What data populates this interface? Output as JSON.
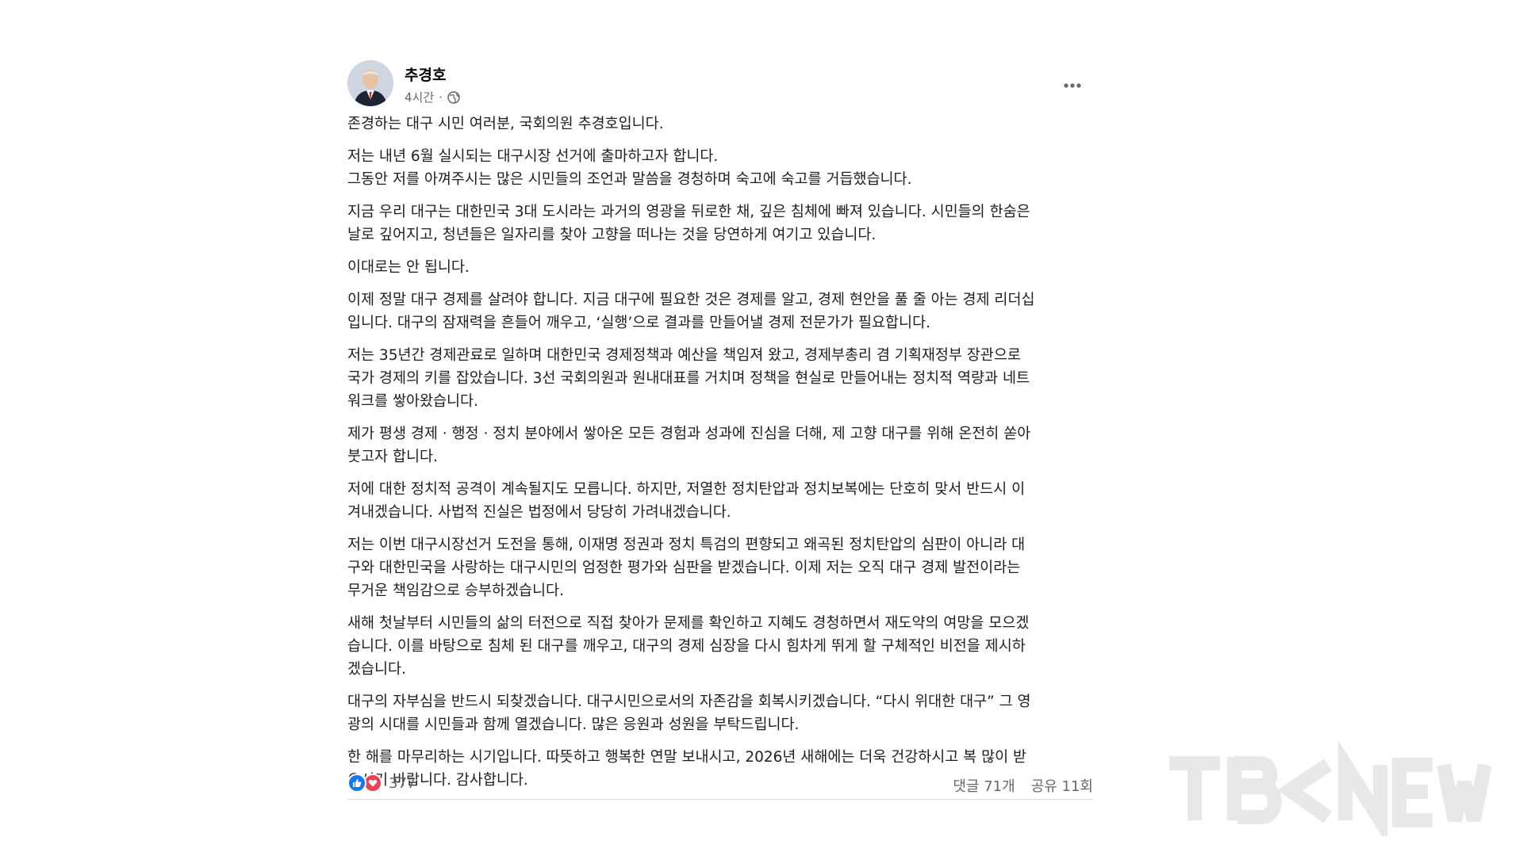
{
  "post": {
    "author": "추경호",
    "time": "4시간",
    "meta_separator": "·",
    "privacy_icon": "globe-icon",
    "more_icon": "more-options-icon",
    "paragraphs": [
      "존경하는 대구 시민 여러분, 국회의원 추경호입니다.",
      "저는 내년 6월 실시되는 대구시장 선거에 출마하고자 합니다.\n그동안 저를 아껴주시는 많은 시민들의 조언과 말씀을 경청하며 숙고에 숙고를 거듭했습니다.",
      "지금 우리 대구는 대한민국 3대 도시라는 과거의 영광을 뒤로한 채, 깊은 침체에 빠져 있습니다. 시민들의 한숨은\n날로 깊어지고, 청년들은 일자리를 찾아 고향을 떠나는 것을 당연하게 여기고 있습니다.",
      "이대로는 안 됩니다.",
      "이제 정말 대구 경제를 살려야 합니다. 지금 대구에 필요한 것은 경제를 알고, 경제 현안을 풀 줄 아는 경제 리더십\n입니다. 대구의 잠재력을 흔들어 깨우고, ‘실행’으로 결과를 만들어낼 경제 전문가가 필요합니다.",
      "저는 35년간 경제관료로 일하며 대한민국 경제정책과 예산을 책임져 왔고, 경제부총리 겸 기획재정부 장관으로\n국가 경제의 키를 잡았습니다. 3선 국회의원과 원내대표를 거치며 정책을 현실로 만들어내는 정치적 역량과 네트\n워크를 쌓아왔습니다.",
      "제가 평생 경제 · 행정 · 정치 분야에서 쌓아온 모든 경험과 성과에 진심을 더해, 제 고향 대구를 위해 온전히 쏟아\n붓고자 합니다.",
      "저에 대한 정치적 공격이 계속될지도 모릅니다. 하지만, 저열한 정치탄압과 정치보복에는 단호히 맞서 반드시 이\n겨내겠습니다. 사법적 진실은 법정에서 당당히 가려내겠습니다.",
      "저는 이번 대구시장선거 도전을 통해, 이재명 정권과 정치 특검의 편향되고 왜곡된 정치탄압의 심판이 아니라 대\n구와 대한민국을 사랑하는 대구시민의 엄정한 평가와 심판을 받겠습니다. 이제 저는 오직 대구 경제 발전이라는\n무거운 책임감으로 승부하겠습니다.",
      "새해 첫날부터 시민들의 삶의 터전으로 직접 찾아가 문제를 확인하고 지혜도 경청하면서 재도약의 여망을 모으겠\n습니다. 이를 바탕으로 침체 된 대구를 깨우고, 대구의 경제 심장을 다시 힘차게 뛰게 할 구체적인 비전을 제시하\n겠습니다.",
      "대구의 자부심을 반드시 되찾겠습니다. 대구시민으로서의 자존감을 회복시키겠습니다. “다시 위대한 대구” 그 영\n광의 시대를 시민들과 함께 열겠습니다. 많은 응원과 성원을 부탁드립니다.",
      "한 해를 마무리하는 시기입니다. 따뜻하고 행복한 연말 보내시고, 2026년 새해에는 더욱 건강하시고 복 많이 받\n으시기 바랍니다. 감사합니다."
    ],
    "reactions": {
      "count": "377",
      "icons": [
        "like-icon",
        "love-icon"
      ]
    },
    "comments": "댓글 71개",
    "shares": "공유 11회"
  },
  "watermark": {
    "text": "TBCNEWS"
  },
  "colors": {
    "like_blue": "#1877f2",
    "love_red": "#f33e58",
    "secondary_text": "#65676b"
  }
}
